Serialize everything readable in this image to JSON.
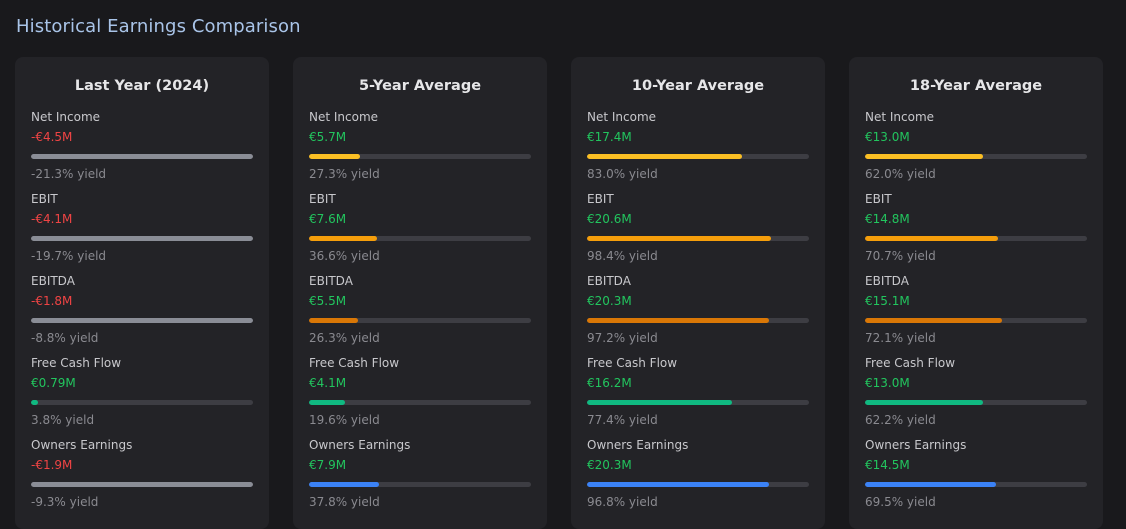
{
  "page": {
    "title": "Historical Earnings Comparison"
  },
  "colors": {
    "negative_text": "#ef4444",
    "positive_text": "#22c55e",
    "bar_gray": "#8a8d96",
    "bar_yellow": "#fbbf24",
    "bar_orange_light": "#f59e0b",
    "bar_orange": "#d97706",
    "bar_green": "#10b981",
    "bar_blue": "#3b82f6"
  },
  "cards": [
    {
      "title": "Last Year (2024)",
      "metrics": [
        {
          "label": "Net Income",
          "value": "-€4.5M",
          "sign": "neg",
          "yield": "-21.3% yield",
          "fill": 1.0,
          "color": "#8a8d96"
        },
        {
          "label": "EBIT",
          "value": "-€4.1M",
          "sign": "neg",
          "yield": "-19.7% yield",
          "fill": 1.0,
          "color": "#8a8d96"
        },
        {
          "label": "EBITDA",
          "value": "-€1.8M",
          "sign": "neg",
          "yield": "-8.8% yield",
          "fill": 1.0,
          "color": "#8a8d96"
        },
        {
          "label": "Free Cash Flow",
          "value": "€0.79M",
          "sign": "pos",
          "yield": "3.8% yield",
          "fill": 0.03,
          "color": "#10b981"
        },
        {
          "label": "Owners Earnings",
          "value": "-€1.9M",
          "sign": "neg",
          "yield": "-9.3% yield",
          "fill": 1.0,
          "color": "#8a8d96"
        }
      ]
    },
    {
      "title": "5-Year Average",
      "metrics": [
        {
          "label": "Net Income",
          "value": "€5.7M",
          "sign": "pos",
          "yield": "27.3% yield",
          "fill": 0.23,
          "color": "#fbbf24"
        },
        {
          "label": "EBIT",
          "value": "€7.6M",
          "sign": "pos",
          "yield": "36.6% yield",
          "fill": 0.305,
          "color": "#f59e0b"
        },
        {
          "label": "EBITDA",
          "value": "€5.5M",
          "sign": "pos",
          "yield": "26.3% yield",
          "fill": 0.22,
          "color": "#d97706"
        },
        {
          "label": "Free Cash Flow",
          "value": "€4.1M",
          "sign": "pos",
          "yield": "19.6% yield",
          "fill": 0.163,
          "color": "#10b981"
        },
        {
          "label": "Owners Earnings",
          "value": "€7.9M",
          "sign": "pos",
          "yield": "37.8% yield",
          "fill": 0.315,
          "color": "#3b82f6"
        }
      ]
    },
    {
      "title": "10-Year Average",
      "metrics": [
        {
          "label": "Net Income",
          "value": "€17.4M",
          "sign": "pos",
          "yield": "83.0% yield",
          "fill": 0.7,
          "color": "#fbbf24"
        },
        {
          "label": "EBIT",
          "value": "€20.6M",
          "sign": "pos",
          "yield": "98.4% yield",
          "fill": 0.83,
          "color": "#f59e0b"
        },
        {
          "label": "EBITDA",
          "value": "€20.3M",
          "sign": "pos",
          "yield": "97.2% yield",
          "fill": 0.82,
          "color": "#d97706"
        },
        {
          "label": "Free Cash Flow",
          "value": "€16.2M",
          "sign": "pos",
          "yield": "77.4% yield",
          "fill": 0.655,
          "color": "#10b981"
        },
        {
          "label": "Owners Earnings",
          "value": "€20.3M",
          "sign": "pos",
          "yield": "96.8% yield",
          "fill": 0.82,
          "color": "#3b82f6"
        }
      ]
    },
    {
      "title": "18-Year Average",
      "metrics": [
        {
          "label": "Net Income",
          "value": "€13.0M",
          "sign": "pos",
          "yield": "62.0% yield",
          "fill": 0.53,
          "color": "#fbbf24"
        },
        {
          "label": "EBIT",
          "value": "€14.8M",
          "sign": "pos",
          "yield": "70.7% yield",
          "fill": 0.6,
          "color": "#f59e0b"
        },
        {
          "label": "EBITDA",
          "value": "€15.1M",
          "sign": "pos",
          "yield": "72.1% yield",
          "fill": 0.615,
          "color": "#d97706"
        },
        {
          "label": "Free Cash Flow",
          "value": "€13.0M",
          "sign": "pos",
          "yield": "62.2% yield",
          "fill": 0.53,
          "color": "#10b981"
        },
        {
          "label": "Owners Earnings",
          "value": "€14.5M",
          "sign": "pos",
          "yield": "69.5% yield",
          "fill": 0.59,
          "color": "#3b82f6"
        }
      ]
    }
  ]
}
